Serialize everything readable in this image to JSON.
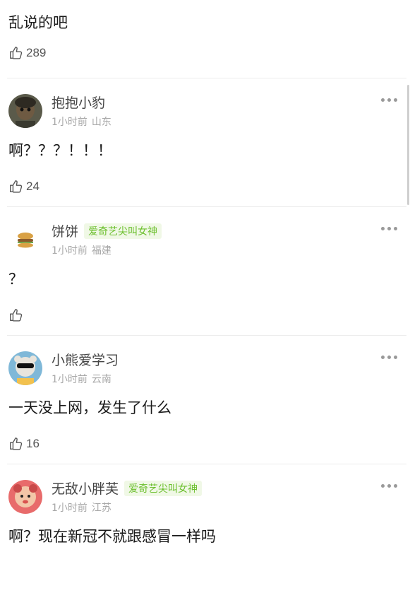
{
  "top_comment": {
    "text": "乱说的吧",
    "likes": "289"
  },
  "comments": [
    {
      "username": "抱抱小豹",
      "badge": "",
      "time": "1小时前",
      "location": "山东",
      "text": "啊？？？！！！",
      "likes": "24"
    },
    {
      "username": "饼饼",
      "badge": "爱奇艺尖叫女神",
      "time": "1小时前",
      "location": "福建",
      "text": "？",
      "likes": ""
    },
    {
      "username": "小熊爱学习",
      "badge": "",
      "time": "1小时前",
      "location": "云南",
      "text": "一天没上网，发生了什么",
      "likes": "16"
    },
    {
      "username": "无敌小胖芙",
      "badge": "爱奇艺尖叫女神",
      "time": "1小时前",
      "location": "江苏",
      "text": "啊？现在新冠不就跟感冒一样吗",
      "likes": ""
    }
  ],
  "colors": {
    "badge_text": "#6bbf2c",
    "badge_bg": "#f0f8e6",
    "meta": "#a8a8a8"
  }
}
